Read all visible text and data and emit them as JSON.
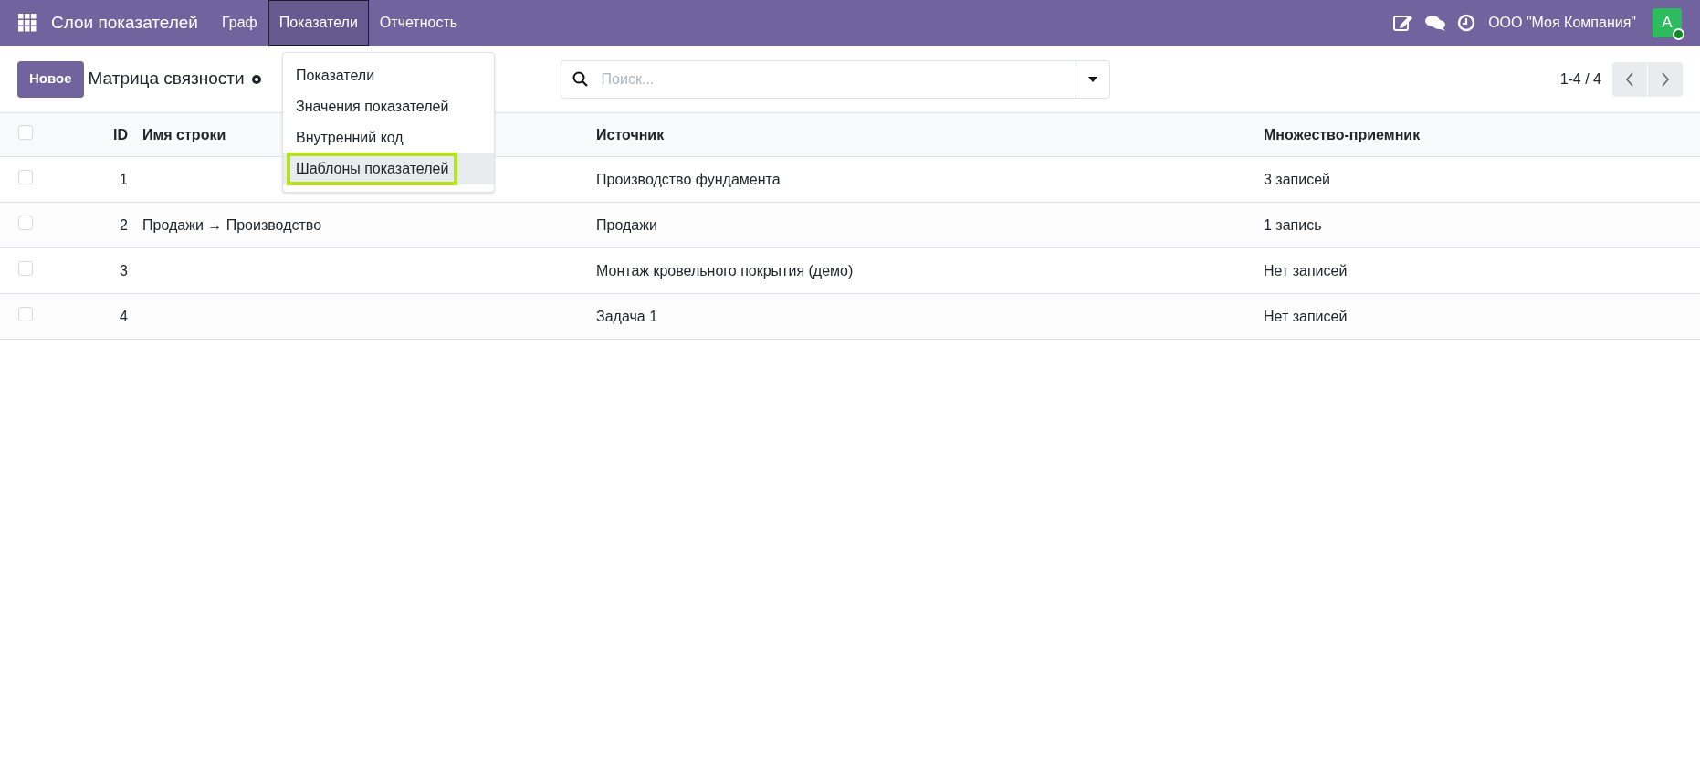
{
  "navbar": {
    "app_title": "Слои показателей",
    "menu": [
      {
        "label": "Граф",
        "selected": false
      },
      {
        "label": "Показатели",
        "selected": true
      },
      {
        "label": "Отчетность",
        "selected": false
      }
    ],
    "company": "ООО \"Моя Компания\"",
    "avatar": "A"
  },
  "dropdown": {
    "items": [
      {
        "label": "Показатели",
        "highlighted": false
      },
      {
        "label": "Значения показателей",
        "highlighted": false
      },
      {
        "label": "Внутренний код",
        "highlighted": false
      },
      {
        "label": "Шаблоны показателей",
        "highlighted": true
      }
    ]
  },
  "control_panel": {
    "new_button": "Новое",
    "breadcrumb": "Матрица связности",
    "search": {
      "placeholder": "Поиск..."
    },
    "pager": "1-4 / 4"
  },
  "table": {
    "all_checked": false,
    "columns": [
      "ID",
      "Имя строки",
      "Источник",
      "Множество-приемник"
    ],
    "rows": [
      {
        "id": "1",
        "source": "Производство фундамента",
        "target": "3 записей",
        "checked": false
      },
      {
        "id": "2",
        "name": "Продажи → Производство",
        "source": "Продажи",
        "target": "1 запись",
        "checked": false
      },
      {
        "id": "3",
        "source": "Монтаж кровельного покрытия (демо)",
        "target": "Нет записей",
        "checked": false
      },
      {
        "id": "4",
        "source": "Задача 1",
        "target": "Нет записей",
        "checked": false
      }
    ]
  }
}
